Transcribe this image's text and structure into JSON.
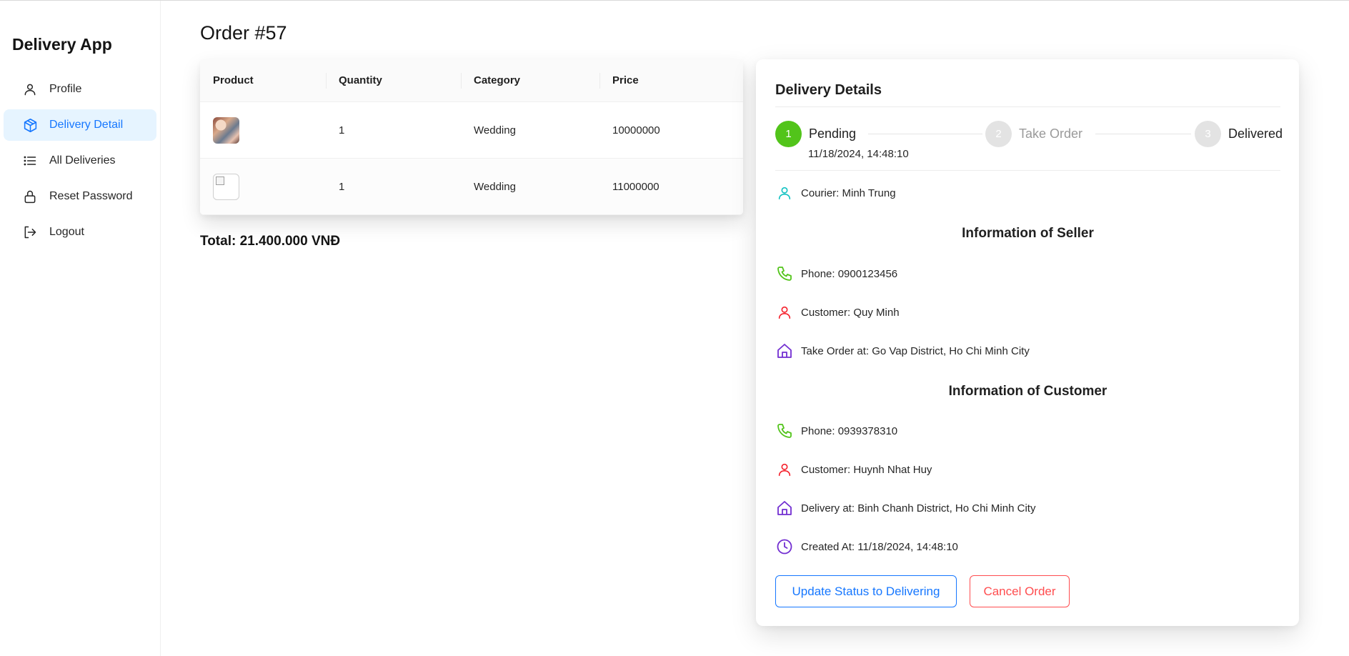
{
  "app": {
    "title": "Delivery App"
  },
  "sidebar": {
    "items": [
      {
        "label": "Profile",
        "icon": "user-icon",
        "active": false
      },
      {
        "label": "Delivery Detail",
        "icon": "package-icon",
        "active": true
      },
      {
        "label": "All Deliveries",
        "icon": "list-icon",
        "active": false
      },
      {
        "label": "Reset Password",
        "icon": "lock-icon",
        "active": false
      },
      {
        "label": "Logout",
        "icon": "logout-icon",
        "active": false
      }
    ]
  },
  "order": {
    "title": "Order #57",
    "columns": [
      "Product",
      "Quantity",
      "Category",
      "Price"
    ],
    "rows": [
      {
        "product_image": "product-thumbnail",
        "quantity": "1",
        "category": "Wedding",
        "price": "10000000"
      },
      {
        "product_image": "broken-image",
        "quantity": "1",
        "category": "Wedding",
        "price": "11000000"
      }
    ],
    "total": "Total: 21.400.000 VNĐ"
  },
  "delivery": {
    "title": "Delivery Details",
    "steps": [
      {
        "number": "1",
        "label": "Pending",
        "status": "active",
        "time": "11/18/2024, 14:48:10"
      },
      {
        "number": "2",
        "label": "Take Order",
        "status": "wait"
      },
      {
        "number": "3",
        "label": "Delivered",
        "status": "wait"
      }
    ],
    "courier": "Courier: Minh Trung",
    "seller": {
      "title": "Information of Seller",
      "phone": "Phone: 0900123456",
      "customer": "Customer: Quy Minh",
      "address": "Take Order at: Go Vap District, Ho Chi Minh City"
    },
    "customer": {
      "title": "Information of Customer",
      "phone": "Phone: 0939378310",
      "customer": "Customer: Huynh Nhat Huy",
      "address": "Delivery at: Binh Chanh District, Ho Chi Minh City",
      "created": "Created At: 11/18/2024, 14:48:10"
    },
    "actions": {
      "update_label": "Update Status to Delivering",
      "cancel_label": "Cancel Order"
    }
  },
  "colors": {
    "primary": "#1677ff",
    "success": "#52c41a",
    "danger": "#ff4d4f",
    "cyan": "#13c2c2",
    "purple": "#722ed1",
    "red_icon": "#f5222d"
  }
}
